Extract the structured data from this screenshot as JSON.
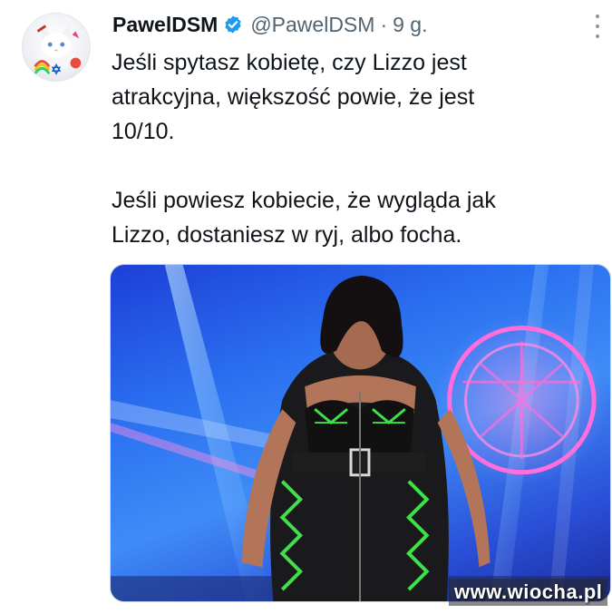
{
  "tweet": {
    "display_name": "PawelDSM",
    "handle": "@PawelDSM",
    "separator": "·",
    "time": "9 g.",
    "verified_icon": "verified-badge-icon",
    "more_icon": "more-options-icon",
    "text": {
      "paragraph1_line1": "Jeśli spytasz kobietę, czy Lizzo jest",
      "paragraph1_line2": "atrakcyjna, większość powie, że jest",
      "paragraph1_line3": "10/10.",
      "paragraph2_line1": "Jeśli powiesz kobiecie, że wygląda jak",
      "paragraph2_line2": "Lizzo, dostaniesz w ryj, albo focha."
    }
  },
  "watermark": "www.wiocha.pl",
  "colors": {
    "text": "#0f1419",
    "secondary": "#536471",
    "verified": "#1d9bf0",
    "stage_blue": "#2a6ff0",
    "neon_pink": "#ff5fd2",
    "outfit_green": "#3fe04a"
  }
}
